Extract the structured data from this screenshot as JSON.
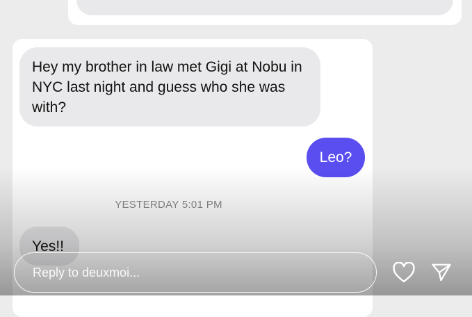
{
  "messages": {
    "incoming_1": "Hey my brother in law met Gigi at Nobu in NYC last night and guess who she was with?",
    "outgoing_1": "Leo?",
    "timestamp": "YESTERDAY 5:01 PM",
    "incoming_2": "Yes!!"
  },
  "reply": {
    "placeholder": "Reply to deuxmoi..."
  },
  "icons": {
    "like": "heart-icon",
    "send": "send-icon"
  },
  "colors": {
    "outgoing_bubble": "#5b4ef1",
    "incoming_bubble": "#e9e9eb"
  }
}
